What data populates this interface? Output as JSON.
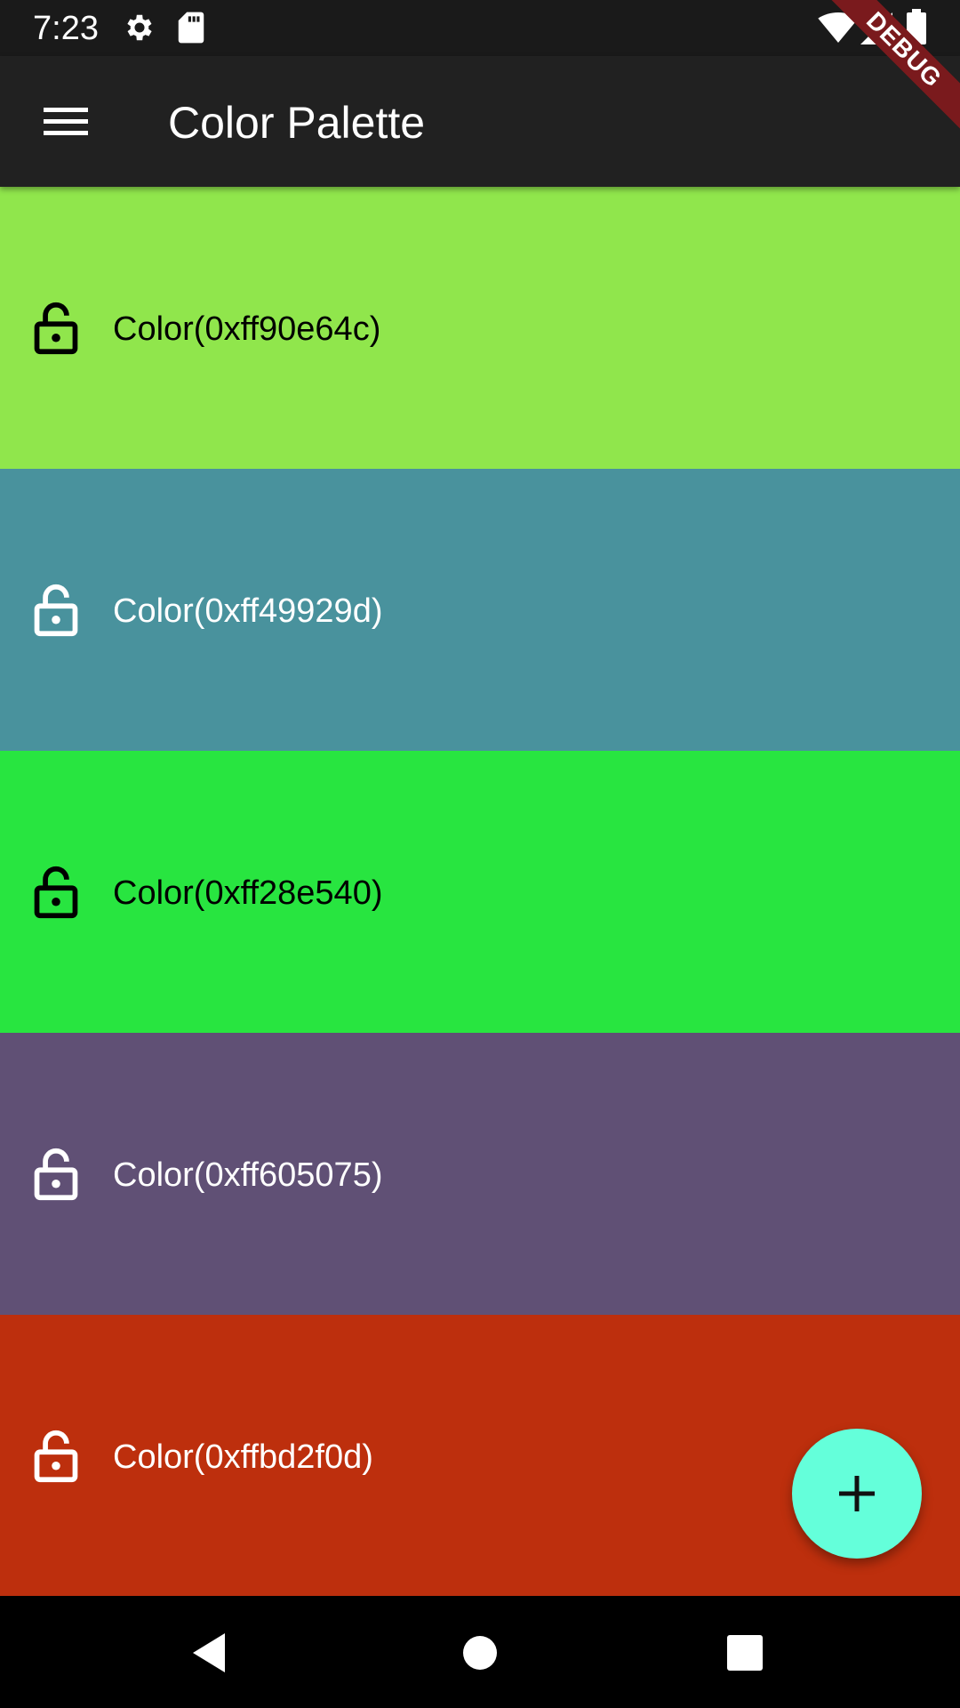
{
  "status_bar": {
    "time": "7:23",
    "icons": [
      "gear-icon",
      "sd-card-icon",
      "wifi-icon",
      "cell-signal-icon",
      "battery-icon"
    ]
  },
  "debug_banner": {
    "label": "DEBUG",
    "color": "#7a1a1d"
  },
  "app_bar": {
    "title": "Color Palette",
    "menu_icon": "menu-icon",
    "background": "#212121"
  },
  "palette": {
    "colors": [
      {
        "label": "Color(0xff90e64c)",
        "hex": "#90e64c",
        "text_color": "#000000",
        "lock_icon": "lock-open-icon"
      },
      {
        "label": "Color(0xff49929d)",
        "hex": "#49929d",
        "text_color": "#ffffff",
        "lock_icon": "lock-open-icon"
      },
      {
        "label": "Color(0xff28e540)",
        "hex": "#28e540",
        "text_color": "#000000",
        "lock_icon": "lock-open-icon"
      },
      {
        "label": "Color(0xff605075)",
        "hex": "#605075",
        "text_color": "#ffffff",
        "lock_icon": "lock-open-icon"
      },
      {
        "label": "Color(0xffbd2f0d)",
        "hex": "#bd2f0d",
        "text_color": "#ffffff",
        "lock_icon": "lock-open-icon"
      }
    ]
  },
  "fab": {
    "icon": "plus-icon",
    "color": "#64ffda"
  },
  "nav_bar": {
    "buttons": [
      "back-icon",
      "home-icon",
      "recents-icon"
    ]
  }
}
